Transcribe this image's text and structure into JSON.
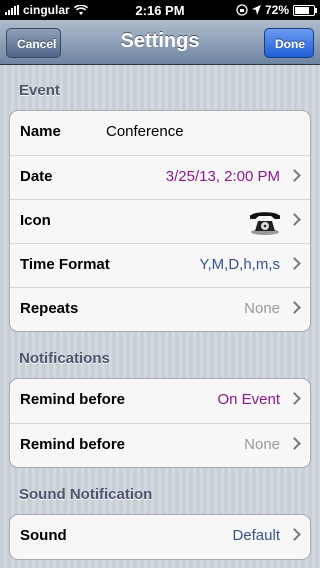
{
  "status": {
    "carrier": "cingular",
    "time": "2:16 PM",
    "battery": "72%",
    "battery_level": 0.72
  },
  "nav": {
    "cancel": "Cancel",
    "title": "Settings",
    "done": "Done"
  },
  "sections": {
    "event": {
      "header": "Event",
      "name_label": "Name",
      "name_value": "Conference",
      "date_label": "Date",
      "date_value": "3/25/13, 2:00 PM",
      "icon_label": "Icon",
      "icon_name": "telephone-icon",
      "timeformat_label": "Time Format",
      "timeformat_value": "Y,M,D,h,m,s",
      "repeats_label": "Repeats",
      "repeats_value": "None"
    },
    "notifications": {
      "header": "Notifications",
      "remind1_label": "Remind before",
      "remind1_value": "On Event",
      "remind2_label": "Remind before",
      "remind2_value": "None"
    },
    "sound": {
      "header": "Sound Notification",
      "sound_label": "Sound",
      "sound_value": "Default"
    }
  },
  "colors": {
    "purple_value": "#8a1a8a",
    "blue_value": "#385487",
    "gray_value": "#9a9a9a"
  }
}
